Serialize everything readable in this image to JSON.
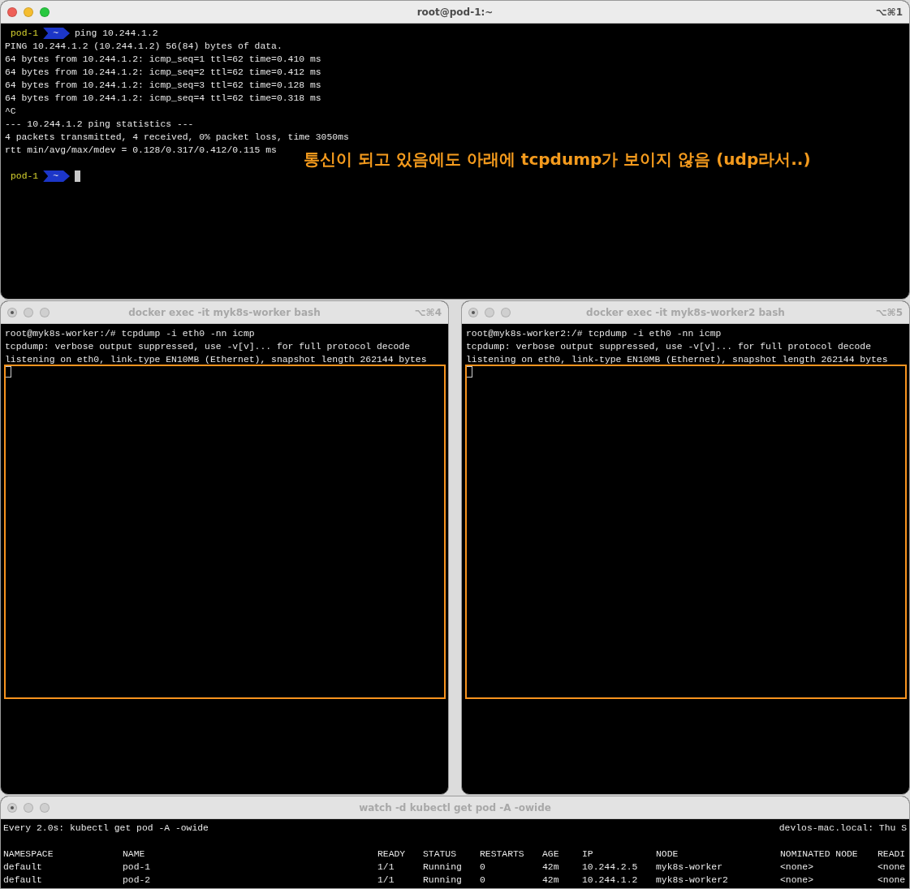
{
  "main_window": {
    "title": "root@pod-1:~",
    "shortcut": "⌥⌘1",
    "active": true,
    "lines": [
      {
        "kind": "prompt",
        "host": "pod-1",
        "dir": "~",
        "command": "ping 10.244.1.2",
        "cursor": false
      },
      {
        "kind": "text",
        "text": "PING 10.244.1.2 (10.244.1.2) 56(84) bytes of data."
      },
      {
        "kind": "text",
        "text": "64 bytes from 10.244.1.2: icmp_seq=1 ttl=62 time=0.410 ms"
      },
      {
        "kind": "text",
        "text": "64 bytes from 10.244.1.2: icmp_seq=2 ttl=62 time=0.412 ms"
      },
      {
        "kind": "text",
        "text": "64 bytes from 10.244.1.2: icmp_seq=3 ttl=62 time=0.128 ms"
      },
      {
        "kind": "text",
        "text": "64 bytes from 10.244.1.2: icmp_seq=4 ttl=62 time=0.318 ms"
      },
      {
        "kind": "text",
        "text": "^C"
      },
      {
        "kind": "text",
        "text": "--- 10.244.1.2 ping statistics ---"
      },
      {
        "kind": "text",
        "text": "4 packets transmitted, 4 received, 0% packet loss, time 3050ms"
      },
      {
        "kind": "text",
        "text": "rtt min/avg/max/mdev = 0.128/0.317/0.412/0.115 ms"
      },
      {
        "kind": "blank"
      },
      {
        "kind": "prompt",
        "host": "pod-1",
        "dir": "~",
        "cursor": true
      }
    ],
    "annotation": "통신이 되고 있음에도 아래에 tcpdump가 보이지 않음 (udp라서..)"
  },
  "panes": [
    {
      "title": "docker exec -it myk8s-worker bash",
      "shortcut": "⌥⌘4",
      "active": false,
      "highlighted": true,
      "lines": [
        {
          "kind": "text",
          "text": "root@myk8s-worker:/# tcpdump -i eth0 -nn icmp"
        },
        {
          "kind": "text",
          "text": "tcpdump: verbose output suppressed, use -v[v]... for full protocol decode"
        },
        {
          "kind": "text",
          "text": "listening on eth0, link-type EN10MB (Ethernet), snapshot length 262144 bytes"
        }
      ]
    },
    {
      "title": "docker exec -it myk8s-worker2 bash",
      "shortcut": "⌥⌘5",
      "active": false,
      "highlighted": true,
      "lines": [
        {
          "kind": "text",
          "text": "root@myk8s-worker2:/# tcpdump -i eth0 -nn icmp"
        },
        {
          "kind": "text",
          "text": "tcpdump: verbose output suppressed, use -v[v]... for full protocol decode"
        },
        {
          "kind": "text",
          "text": "listening on eth0, link-type EN10MB (Ethernet), snapshot length 262144 bytes"
        }
      ]
    }
  ],
  "watch_window": {
    "title": "watch -d kubectl get pod -A -owide",
    "active": false,
    "header_left": "Every 2.0s: kubectl get pod -A -owide",
    "header_right": "devlos-mac.local: Thu S",
    "columns": [
      "NAMESPACE",
      "NAME",
      "READY",
      "STATUS",
      "RESTARTS",
      "AGE",
      "IP",
      "NODE",
      "NOMINATED NODE",
      "READI"
    ],
    "rows": [
      [
        "default",
        "pod-1",
        "1/1",
        "Running",
        "0",
        "42m",
        "10.244.2.5",
        "myk8s-worker",
        "<none>",
        "<none"
      ],
      [
        "default",
        "pod-2",
        "1/1",
        "Running",
        "0",
        "42m",
        "10.244.1.2",
        "myk8s-worker2",
        "<none>",
        "<none"
      ]
    ]
  }
}
